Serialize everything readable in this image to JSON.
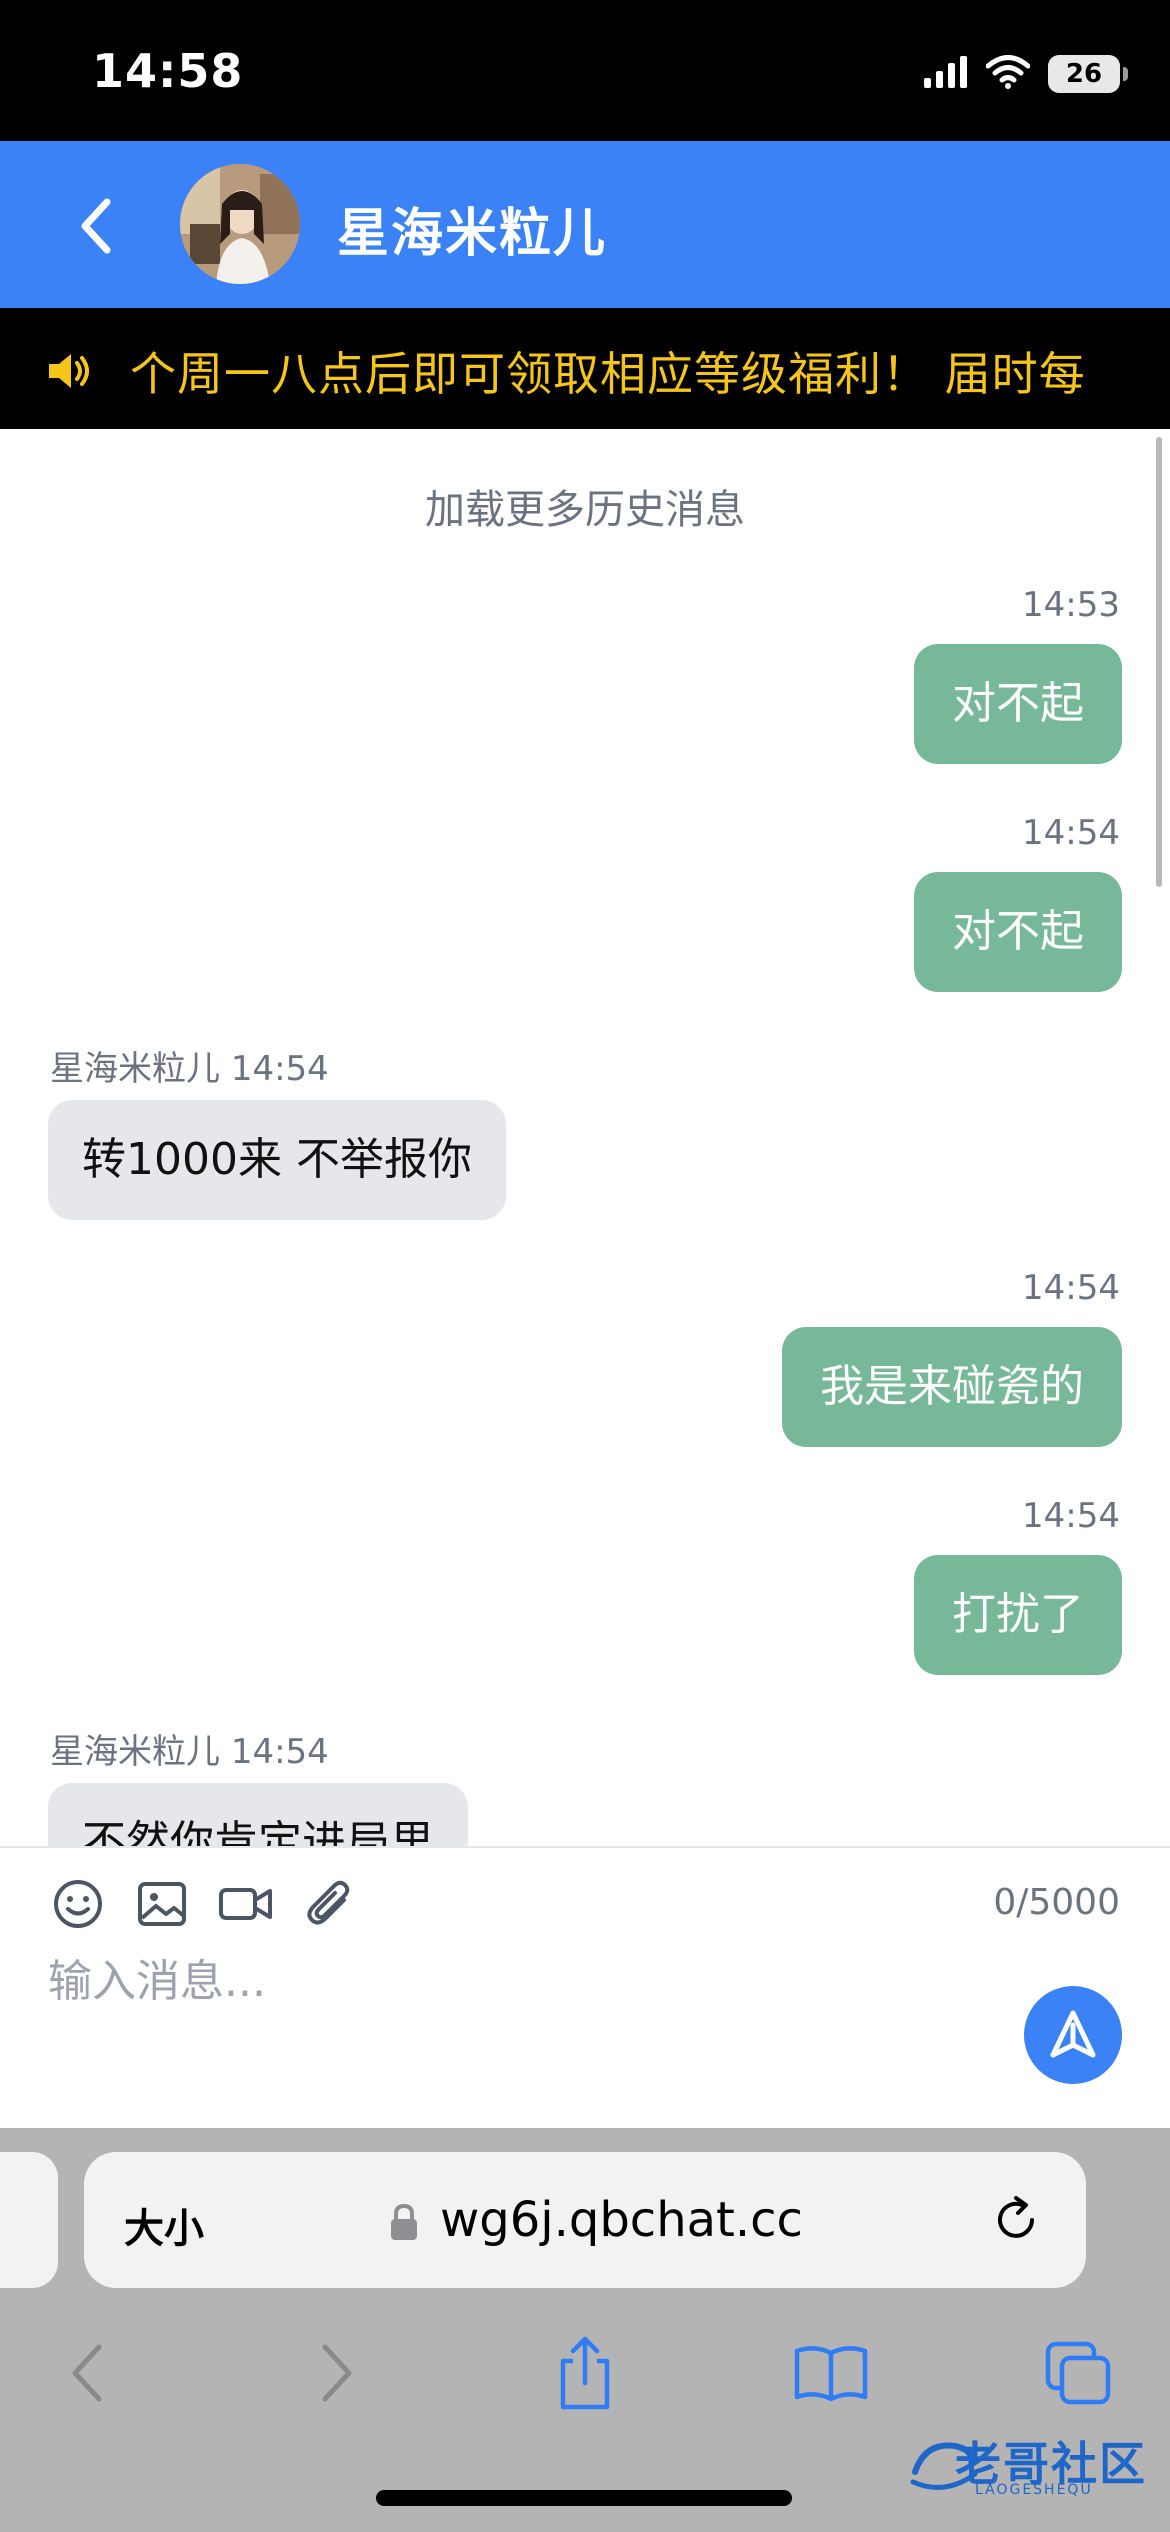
{
  "status_bar": {
    "time": "14:58",
    "battery": "26"
  },
  "header": {
    "contact_name": "星海米粒儿"
  },
  "notice": {
    "text": "个周一八点后即可领取相应等级福利！ 届时每"
  },
  "messages": {
    "load_more": "加载更多历史消息",
    "items": [
      {
        "direction": "out",
        "time": "14:53",
        "text": "对不起"
      },
      {
        "direction": "out",
        "time": "14:54",
        "text": "对不起"
      },
      {
        "direction": "in",
        "sender": "星海米粒儿",
        "time": "14:54",
        "text": "转1000来 不举报你"
      },
      {
        "direction": "out",
        "time": "14:54",
        "text": "我是来碰瓷的"
      },
      {
        "direction": "out",
        "time": "14:54",
        "text": "打扰了"
      },
      {
        "direction": "in",
        "sender": "星海米粒儿",
        "time": "14:54",
        "text": "不然你肯定进局里"
      }
    ]
  },
  "composer": {
    "char_count": "0/5000",
    "placeholder": "输入消息..."
  },
  "browser": {
    "text_size_label": "大小",
    "url": "wg6j.qbchat.cc"
  },
  "watermark": {
    "text": "老哥社区",
    "sub": "LAOGESHEQU"
  },
  "colors": {
    "header_blue": "#3b82f6",
    "outgoing_bubble": "#76b897",
    "incoming_bubble": "#e5e7eb",
    "notice_yellow": "#f5c518"
  }
}
